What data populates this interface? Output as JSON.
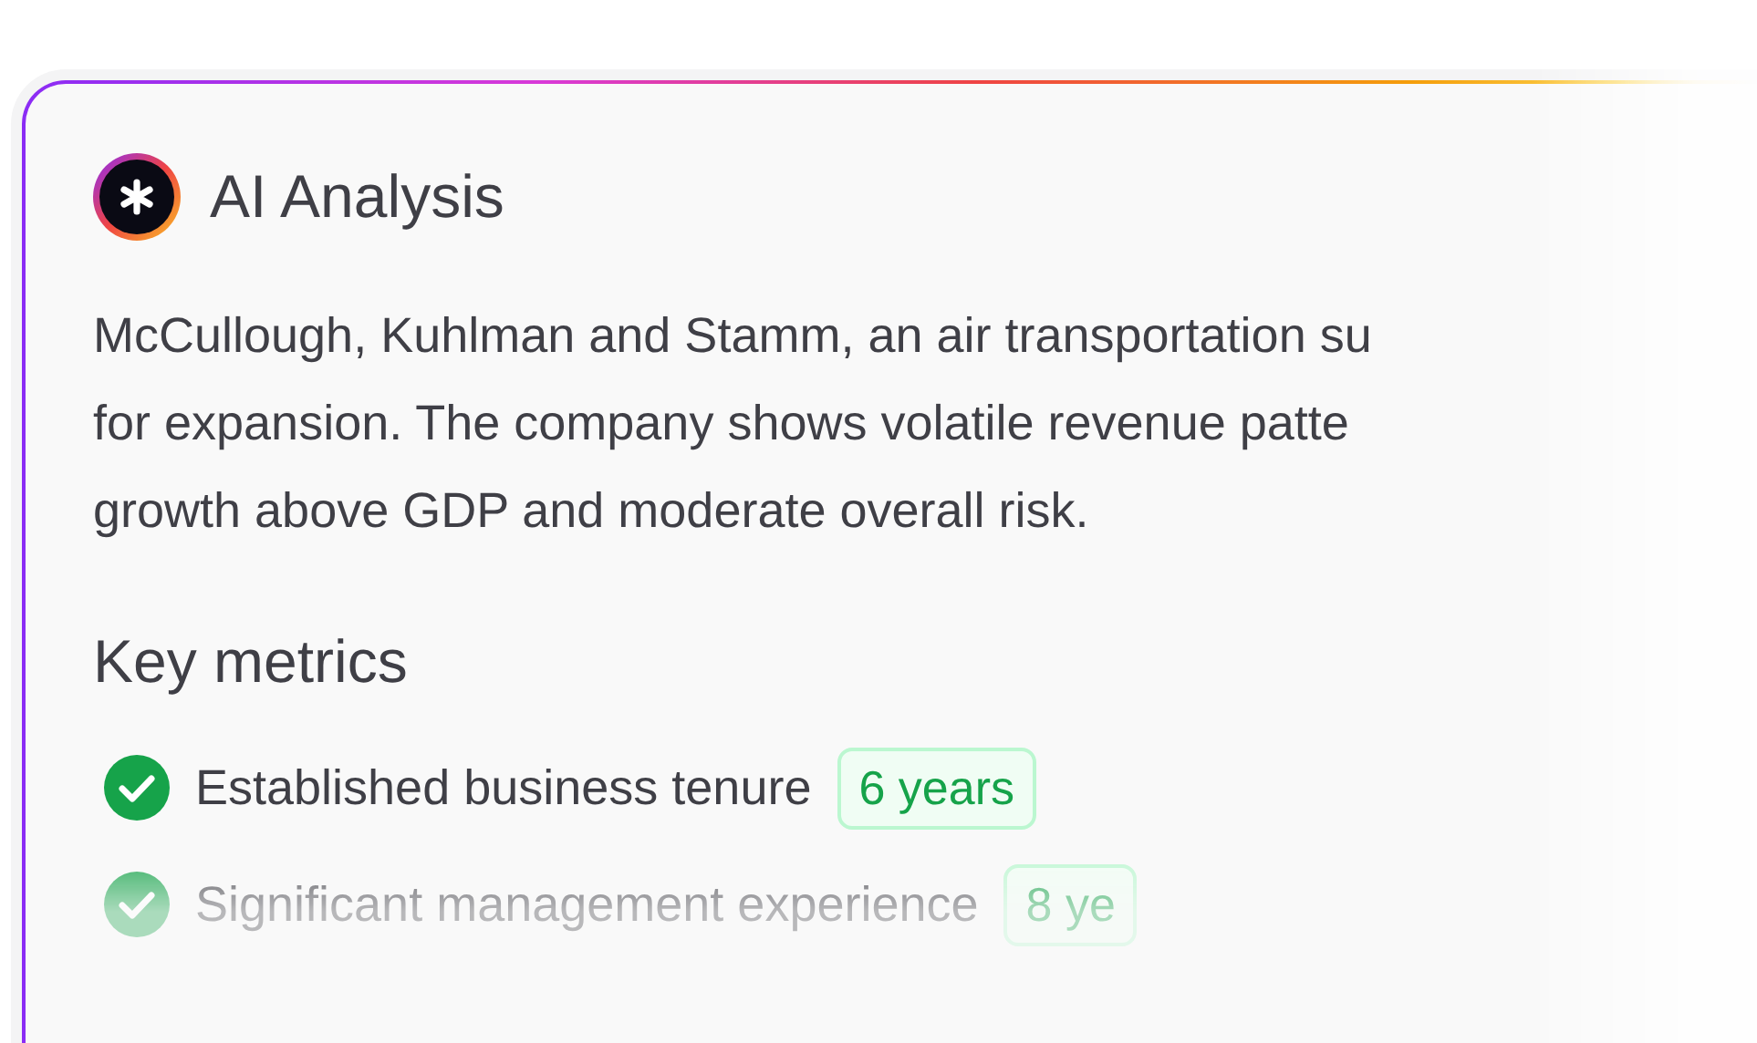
{
  "card": {
    "title": "AI Analysis",
    "summary_lines": [
      "McCullough, Kuhlman and Stamm, an air transportation su",
      "for expansion. The company shows volatile revenue patte",
      "growth above GDP and moderate overall risk."
    ],
    "section_title": "Key metrics",
    "metrics": [
      {
        "label": "Established business tenure",
        "value": "6 years",
        "checked": true
      },
      {
        "label": "Significant management experience",
        "value": "8 ye",
        "checked": true
      }
    ]
  }
}
